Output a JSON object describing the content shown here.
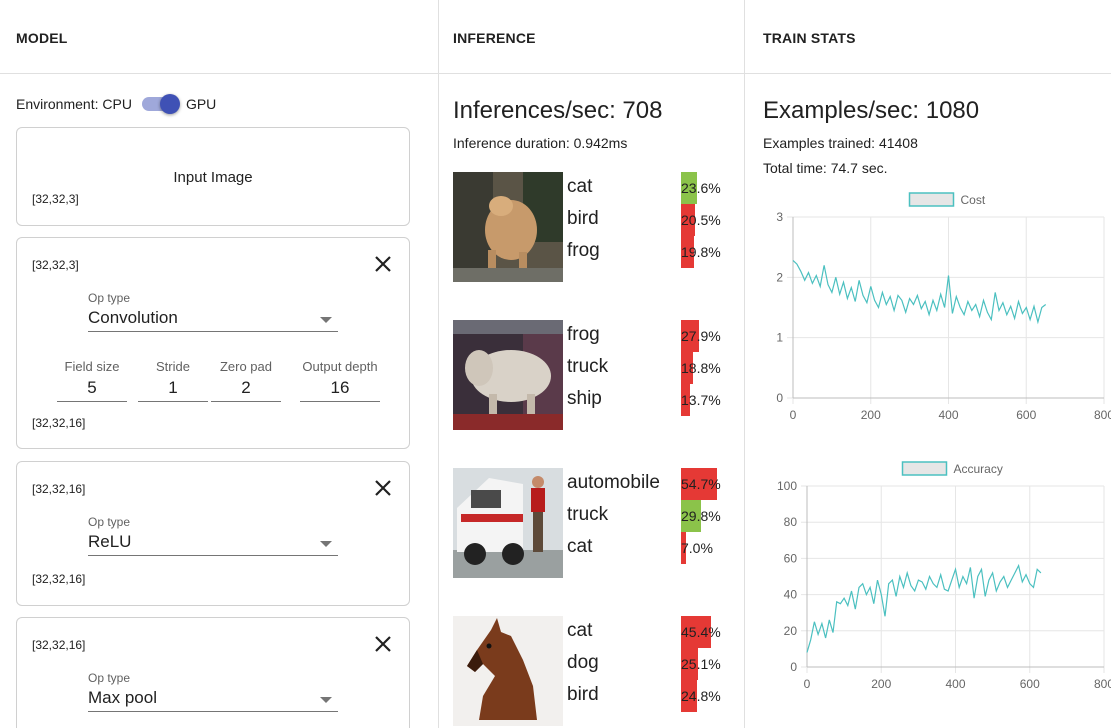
{
  "model": {
    "header": "MODEL",
    "env_label": "Environment: CPU",
    "env_alt": "GPU",
    "input": {
      "title": "Input Image",
      "shape": "[32,32,3]"
    },
    "layers": [
      {
        "in_shape": "[32,32,3]",
        "op_label": "Op type",
        "op": "Convolution",
        "fields": [
          {
            "label": "Field size",
            "value": "5"
          },
          {
            "label": "Stride",
            "value": "1"
          },
          {
            "label": "Zero pad",
            "value": "2"
          },
          {
            "label": "Output depth",
            "value": "16"
          }
        ],
        "out_shape": "[32,32,16]"
      },
      {
        "in_shape": "[32,32,16]",
        "op_label": "Op type",
        "op": "ReLU",
        "out_shape": "[32,32,16]"
      },
      {
        "in_shape": "[32,32,16]",
        "op_label": "Op type",
        "op": "Max pool"
      }
    ]
  },
  "inference": {
    "header": "INFERENCE",
    "rate": "Inferences/sec: 708",
    "duration": "Inference duration: 0.942ms",
    "items": [
      {
        "image": "cat",
        "preds": [
          {
            "label": "cat",
            "pct": "23.6%",
            "value": 23.6,
            "correct": true
          },
          {
            "label": "bird",
            "pct": "20.5%",
            "value": 20.5,
            "correct": false
          },
          {
            "label": "frog",
            "pct": "19.8%",
            "value": 19.8,
            "correct": false
          }
        ]
      },
      {
        "image": "horse",
        "preds": [
          {
            "label": "frog",
            "pct": "27.9%",
            "value": 27.9,
            "correct": false
          },
          {
            "label": "truck",
            "pct": "18.8%",
            "value": 18.8,
            "correct": false
          },
          {
            "label": "ship",
            "pct": "13.7%",
            "value": 13.7,
            "correct": false
          }
        ]
      },
      {
        "image": "truck",
        "preds": [
          {
            "label": "automobile",
            "pct": "54.7%",
            "value": 54.7,
            "correct": false
          },
          {
            "label": "truck",
            "pct": "29.8%",
            "value": 29.8,
            "correct": true
          },
          {
            "label": "cat",
            "pct": "7.0%",
            "value": 7.0,
            "correct": false
          }
        ]
      },
      {
        "image": "horse",
        "preds": [
          {
            "label": "cat",
            "pct": "45.4%",
            "value": 45.4,
            "correct": false
          },
          {
            "label": "dog",
            "pct": "25.1%",
            "value": 25.1,
            "correct": false
          },
          {
            "label": "bird",
            "pct": "24.8%",
            "value": 24.8,
            "correct": false
          }
        ]
      }
    ],
    "colors": {
      "correct": "#8bc34a",
      "wrong": "#e53935"
    }
  },
  "stats": {
    "header": "TRAIN STATS",
    "rate": "Examples/sec: 1080",
    "trained": "Examples trained: 41408",
    "time": "Total time: 74.7 sec."
  },
  "chart_data": [
    {
      "type": "line",
      "title": "Cost",
      "legend": "top",
      "grid": true,
      "color": "#4bc0c0",
      "xlim": [
        0,
        800
      ],
      "ylim": [
        0,
        3
      ],
      "xticks": [
        0,
        200,
        400,
        600,
        800
      ],
      "yticks": [
        0,
        1,
        2,
        3
      ],
      "series": [
        {
          "name": "Cost",
          "x": [
            0,
            10,
            20,
            30,
            40,
            50,
            60,
            70,
            80,
            90,
            100,
            110,
            120,
            130,
            140,
            150,
            160,
            170,
            180,
            190,
            200,
            210,
            220,
            230,
            240,
            250,
            260,
            270,
            280,
            290,
            300,
            310,
            320,
            330,
            340,
            350,
            360,
            370,
            380,
            390,
            400,
            410,
            420,
            430,
            440,
            450,
            460,
            470,
            480,
            490,
            500,
            510,
            520,
            530,
            540,
            550,
            560,
            570,
            580,
            590,
            600,
            610,
            620,
            630,
            640,
            650
          ],
          "y": [
            2.28,
            2.22,
            2.1,
            1.95,
            2.08,
            1.9,
            2.03,
            1.85,
            2.2,
            1.88,
            1.75,
            2.0,
            1.72,
            1.92,
            1.65,
            1.83,
            1.6,
            1.95,
            1.7,
            1.58,
            1.85,
            1.62,
            1.5,
            1.75,
            1.55,
            1.68,
            1.45,
            1.7,
            1.62,
            1.42,
            1.65,
            1.55,
            1.7,
            1.48,
            1.6,
            1.38,
            1.62,
            1.45,
            1.72,
            1.5,
            2.03,
            1.4,
            1.68,
            1.5,
            1.38,
            1.6,
            1.45,
            1.55,
            1.35,
            1.62,
            1.42,
            1.3,
            1.75,
            1.45,
            1.58,
            1.38,
            1.52,
            1.32,
            1.6,
            1.4,
            1.5,
            1.3,
            1.52,
            1.26,
            1.5,
            1.55
          ]
        }
      ]
    },
    {
      "type": "line",
      "title": "Accuracy",
      "legend": "top",
      "grid": true,
      "color": "#4bc0c0",
      "xlim": [
        0,
        800
      ],
      "ylim": [
        0,
        100
      ],
      "xticks": [
        0,
        200,
        400,
        600,
        800
      ],
      "yticks": [
        0,
        20,
        40,
        60,
        80,
        100
      ],
      "series": [
        {
          "name": "Accuracy",
          "x": [
            0,
            10,
            20,
            30,
            40,
            50,
            60,
            70,
            80,
            90,
            100,
            110,
            120,
            130,
            140,
            150,
            160,
            170,
            180,
            190,
            200,
            210,
            220,
            230,
            240,
            250,
            260,
            270,
            280,
            290,
            300,
            310,
            320,
            330,
            340,
            350,
            360,
            370,
            380,
            390,
            400,
            410,
            420,
            430,
            440,
            450,
            460,
            470,
            480,
            490,
            500,
            510,
            520,
            530,
            540,
            550,
            560,
            570,
            580,
            590,
            600,
            610,
            620,
            630
          ],
          "y": [
            8,
            15,
            25,
            18,
            24,
            16,
            26,
            19,
            36,
            35,
            38,
            34,
            42,
            32,
            44,
            46,
            40,
            44,
            35,
            48,
            40,
            28,
            46,
            48,
            39,
            50,
            44,
            52,
            45,
            42,
            48,
            47,
            43,
            50,
            46,
            44,
            51,
            43,
            42,
            48,
            54,
            44,
            50,
            46,
            55,
            38,
            50,
            54,
            39,
            48,
            52,
            42,
            47,
            50,
            44,
            48,
            52,
            56,
            47,
            51,
            46,
            44,
            54,
            52
          ]
        }
      ]
    }
  ]
}
